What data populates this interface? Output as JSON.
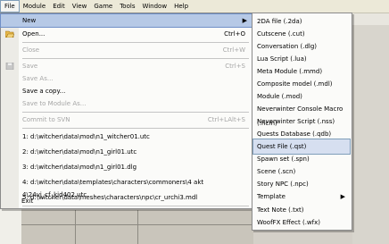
{
  "menubar": {
    "items": [
      "File",
      "Module",
      "Edit",
      "View",
      "Game",
      "Tools",
      "Window",
      "Help"
    ]
  },
  "file_menu": {
    "new": {
      "label": "New"
    },
    "open": {
      "label": "Open...",
      "shortcut": "Ctrl+O"
    },
    "close": {
      "label": "Close",
      "shortcut": "Ctrl+W"
    },
    "save": {
      "label": "Save",
      "shortcut": "Ctrl+S"
    },
    "save_as": {
      "label": "Save As..."
    },
    "save_copy": {
      "label": "Save a copy..."
    },
    "save_to_module": {
      "label": "Save to Module As..."
    },
    "commit": {
      "label": "Commit to SVN",
      "shortcut": "Ctrl+LAlt+S"
    },
    "recent": [
      "1: d:\\witcher\\data\\mod\\n1_witcher01.utc",
      "2: d:\\witcher\\data\\mod\\n1_girl01.utc",
      "3: d:\\witcher\\data\\mod\\n1_girl01.dlg",
      "4: d:\\witcher\\data\\templates\\characters\\commoners\\4 akt 4\\24vi_cf_kid402.utc",
      "5: d:\\witcher\\data\\meshes\\characters\\npc\\cr_urchi3.mdl"
    ],
    "exit": {
      "label": "Exit"
    }
  },
  "new_submenu": {
    "items": [
      "2DA file (.2da)",
      "Cutscene (.cut)",
      "Conversation (.dlg)",
      "Lua Script (.lua)",
      "Meta Module (.mmd)",
      "Composite model (.mdl)",
      "Module (.mod)",
      "Neverwinter Console Macro (.ncm)",
      "Neverwinter Script (.nss)",
      "Quests Database (.qdb)",
      "Quest File (.qst)",
      "Spawn set (.spn)",
      "Scene (.scn)",
      "Story NPC (.npc)",
      "Template",
      "Text Note (.txt)",
      "WoofFX Effect (.wfx)"
    ],
    "highlighted": "Quest File (.qst)"
  }
}
